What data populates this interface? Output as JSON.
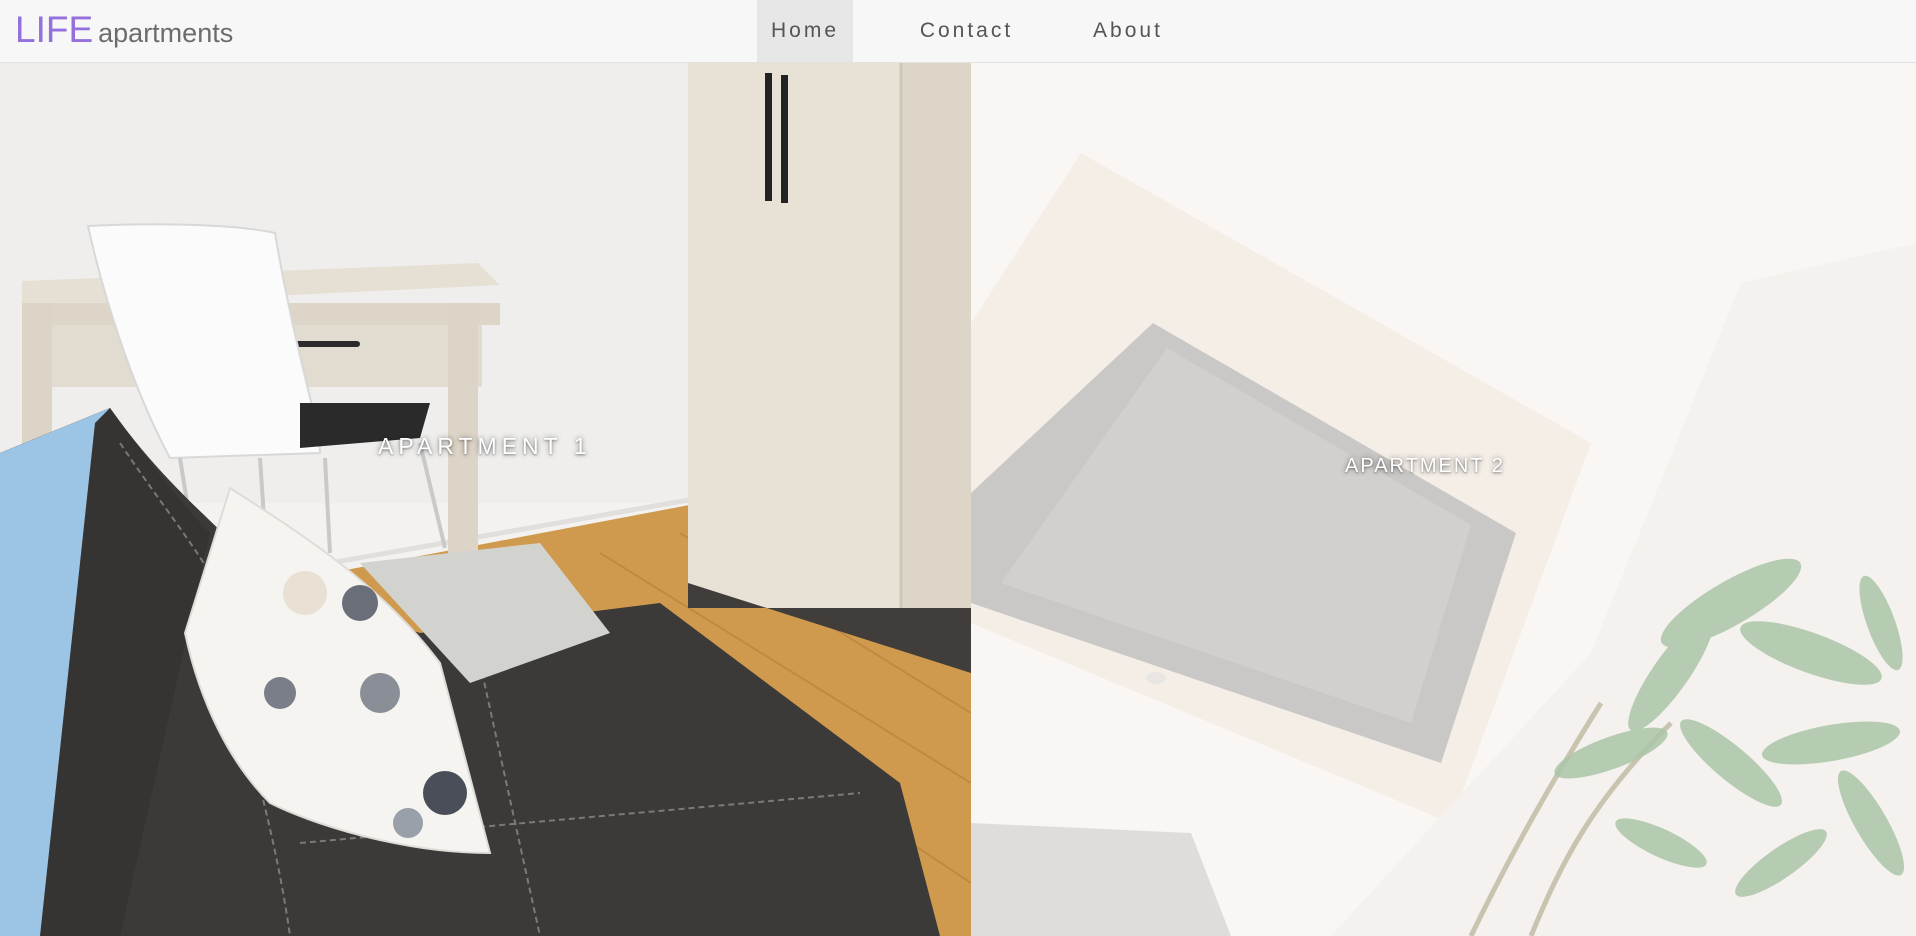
{
  "brand": {
    "main": "LIFE",
    "sub": "apartments",
    "color": "#9370db"
  },
  "nav": {
    "items": [
      {
        "label": "Home",
        "active": true
      },
      {
        "label": "Contact",
        "active": false
      },
      {
        "label": "About",
        "active": false
      }
    ]
  },
  "panels": [
    {
      "label": "APARTMENT 1"
    },
    {
      "label": "APARTMENT 2"
    }
  ]
}
